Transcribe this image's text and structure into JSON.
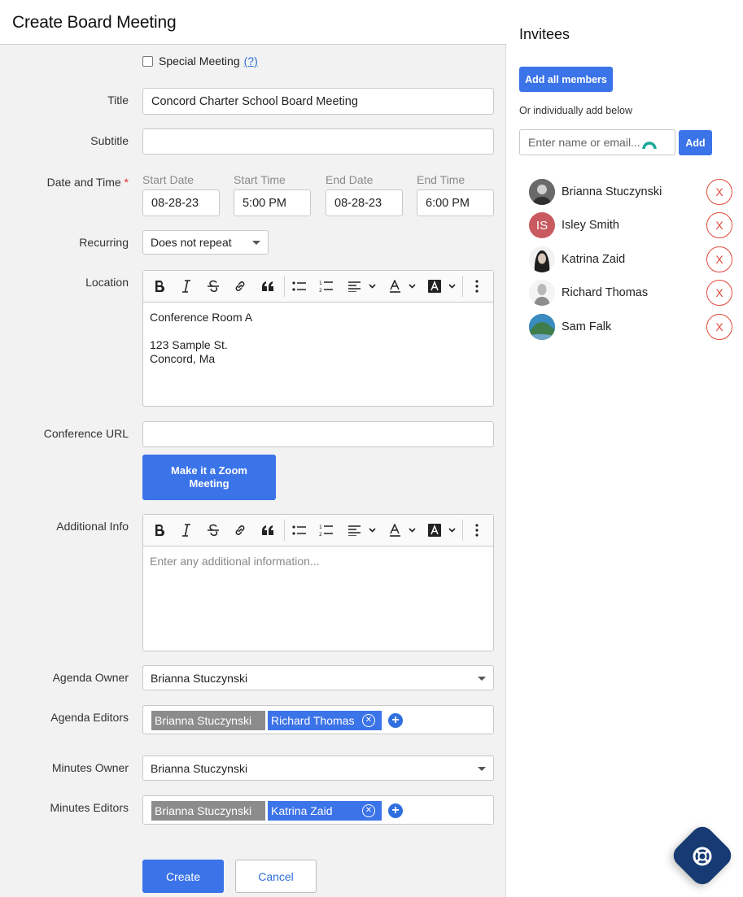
{
  "header": {
    "title": "Create Board Meeting"
  },
  "special_meeting": {
    "label": "Special Meeting",
    "help": "(?)"
  },
  "title_field": {
    "label": "Title",
    "value": "Concord Charter School Board Meeting"
  },
  "subtitle_field": {
    "label": "Subtitle",
    "value": ""
  },
  "datetime": {
    "label": "Date and Time",
    "required_mark": "*",
    "start_date_label": "Start Date",
    "start_date": "08-28-23",
    "start_time_label": "Start Time",
    "start_time": "5:00 PM",
    "end_date_label": "End Date",
    "end_date": "08-28-23",
    "end_time_label": "End Time",
    "end_time": "6:00 PM"
  },
  "recurring": {
    "label": "Recurring",
    "value": "Does not repeat"
  },
  "location": {
    "label": "Location",
    "value": "Conference Room A\n\n123 Sample St.\nConcord, Ma"
  },
  "conference_url": {
    "label": "Conference URL",
    "value": "",
    "zoom_button": "Make it a Zoom Meeting"
  },
  "additional_info": {
    "label": "Additional Info",
    "placeholder": "Enter any additional information..."
  },
  "agenda_owner": {
    "label": "Agenda Owner",
    "value": "Brianna Stuczynski"
  },
  "agenda_editors": {
    "label": "Agenda Editors",
    "locked": "Brianna Stuczynski",
    "selected": "Richard Thomas"
  },
  "minutes_owner": {
    "label": "Minutes Owner",
    "value": "Brianna Stuczynski"
  },
  "minutes_editors": {
    "label": "Minutes Editors",
    "locked": "Brianna Stuczynski",
    "selected": "Katrina Zaid"
  },
  "actions": {
    "create": "Create",
    "cancel": "Cancel"
  },
  "invitees": {
    "title": "Invitees",
    "add_all": "Add all members",
    "hint": "Or individually add below",
    "search_placeholder": "Enter name or email...",
    "add": "Add",
    "remove_label": "X",
    "people": [
      {
        "name": "Brianna Stuczynski",
        "initials": "",
        "color": "#555555"
      },
      {
        "name": "Isley Smith",
        "initials": "IS",
        "color": "#c85a60"
      },
      {
        "name": "Katrina Zaid",
        "initials": "",
        "color": "#2b2b2b"
      },
      {
        "name": "Richard Thomas",
        "initials": "",
        "color": "#9a9a9a"
      },
      {
        "name": "Sam Falk",
        "initials": "",
        "color": "#2f7fb0"
      }
    ]
  },
  "colors": {
    "accent": "#3b73e8",
    "danger": "#e24a3c",
    "fab": "#173a72"
  }
}
